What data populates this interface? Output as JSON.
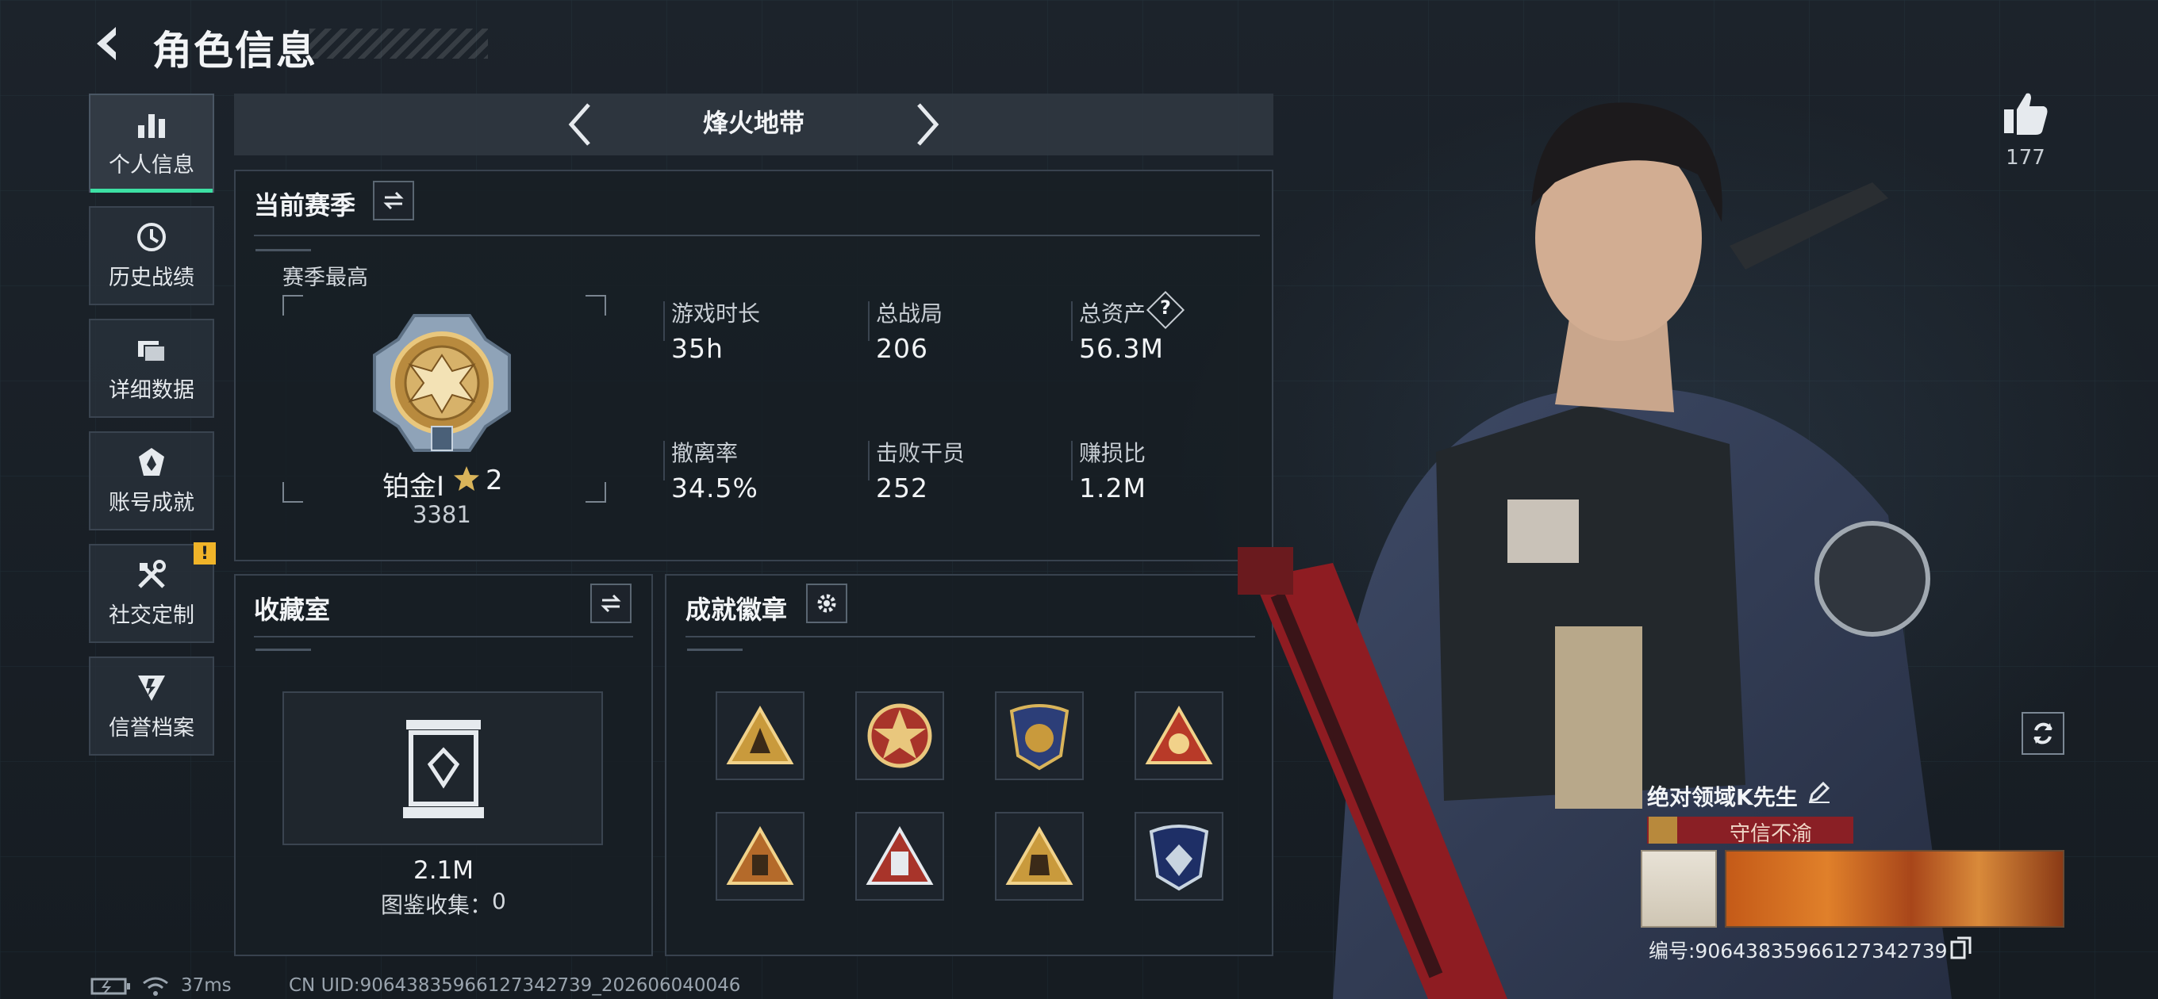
{
  "header": {
    "title": "角色信息"
  },
  "sidebar": {
    "items": [
      {
        "label": "个人信息",
        "icon": "bar-chart-icon",
        "active": true
      },
      {
        "label": "历史战绩",
        "icon": "history-clock-icon"
      },
      {
        "label": "详细数据",
        "icon": "folder-icon"
      },
      {
        "label": "账号成就",
        "icon": "achievement-icon"
      },
      {
        "label": "社交定制",
        "icon": "tools-icon",
        "alert": "!"
      },
      {
        "label": "信誉档案",
        "icon": "reputation-icon"
      }
    ]
  },
  "mode_tab": {
    "label": "烽火地带"
  },
  "season": {
    "title": "当前赛季",
    "best_label": "赛季最高",
    "rank_name": "铂金Ⅰ",
    "rank_stars": "2",
    "rank_score": "3381",
    "stats": [
      {
        "label": "游戏时长",
        "value": "35h"
      },
      {
        "label": "总战局",
        "value": "206"
      },
      {
        "label": "总资产",
        "value": "56.3M",
        "help": "?"
      },
      {
        "label": "撤离率",
        "value": "34.5%"
      },
      {
        "label": "击败干员",
        "value": "252"
      },
      {
        "label": "赚损比",
        "value": "1.2M"
      }
    ]
  },
  "collection": {
    "title": "收藏室",
    "value": "2.1M",
    "catalog_label": "图鉴收集：",
    "catalog_count": "0"
  },
  "achievements": {
    "title": "成就徽章",
    "badges": [
      "badge-1",
      "badge-2",
      "badge-3",
      "badge-4",
      "badge-5",
      "badge-6",
      "badge-7",
      "badge-8"
    ]
  },
  "profile": {
    "likes": "177",
    "name": "绝对领域K先生",
    "title": "守信不渝",
    "uid": "编号:90643835966127342739"
  },
  "status": {
    "ping": "37ms",
    "footer_uid": "CN UID:90643835966127342739_202606040046"
  },
  "colors": {
    "accent": "#3de0a4",
    "warning": "#f0b429",
    "title_red": "#8a1f25"
  }
}
